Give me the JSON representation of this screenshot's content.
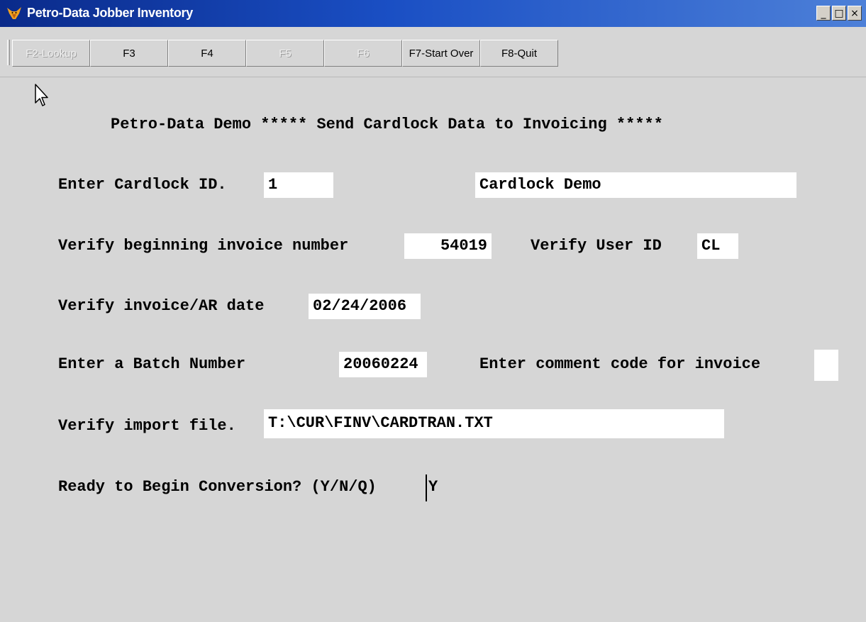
{
  "window": {
    "title": "Petro-Data Jobber Inventory",
    "controls": {
      "minimize": "_",
      "maximize": "□",
      "close": "×"
    }
  },
  "toolbar": {
    "buttons": [
      {
        "label": "F2-Lookup",
        "enabled": false
      },
      {
        "label": "F3",
        "enabled": true
      },
      {
        "label": "F4",
        "enabled": true
      },
      {
        "label": "F5",
        "enabled": false
      },
      {
        "label": "F6",
        "enabled": false
      },
      {
        "label": "F7-Start Over",
        "enabled": true
      },
      {
        "label": "F8-Quit",
        "enabled": true
      }
    ]
  },
  "form": {
    "heading": "Petro-Data Demo ***** Send Cardlock Data to Invoicing *****",
    "cardlock_id_label": "Enter Cardlock ID.",
    "cardlock_id_value": "1",
    "cardlock_name_value": "Cardlock Demo",
    "invoice_number_label": "Verify beginning invoice number",
    "invoice_number_value": "54019",
    "user_id_label": "Verify User ID",
    "user_id_value": "CL",
    "ar_date_label": "Verify invoice/AR date",
    "ar_date_value": "02/24/2006",
    "batch_label": "Enter a Batch Number",
    "batch_value": "20060224",
    "comment_label": "Enter comment code for invoice",
    "comment_value": "",
    "import_file_label": "Verify import file.",
    "import_file_value": "T:\\CUR\\FINV\\CARDTRAN.TXT",
    "ready_label": "Ready to Begin Conversion? (Y/N/Q)",
    "ready_value": "Y"
  },
  "colors": {
    "titlebar_start": "#0a2a8a",
    "titlebar_end": "#4d80d8",
    "background": "#d6d6d6",
    "field_bg": "#ffffff"
  }
}
